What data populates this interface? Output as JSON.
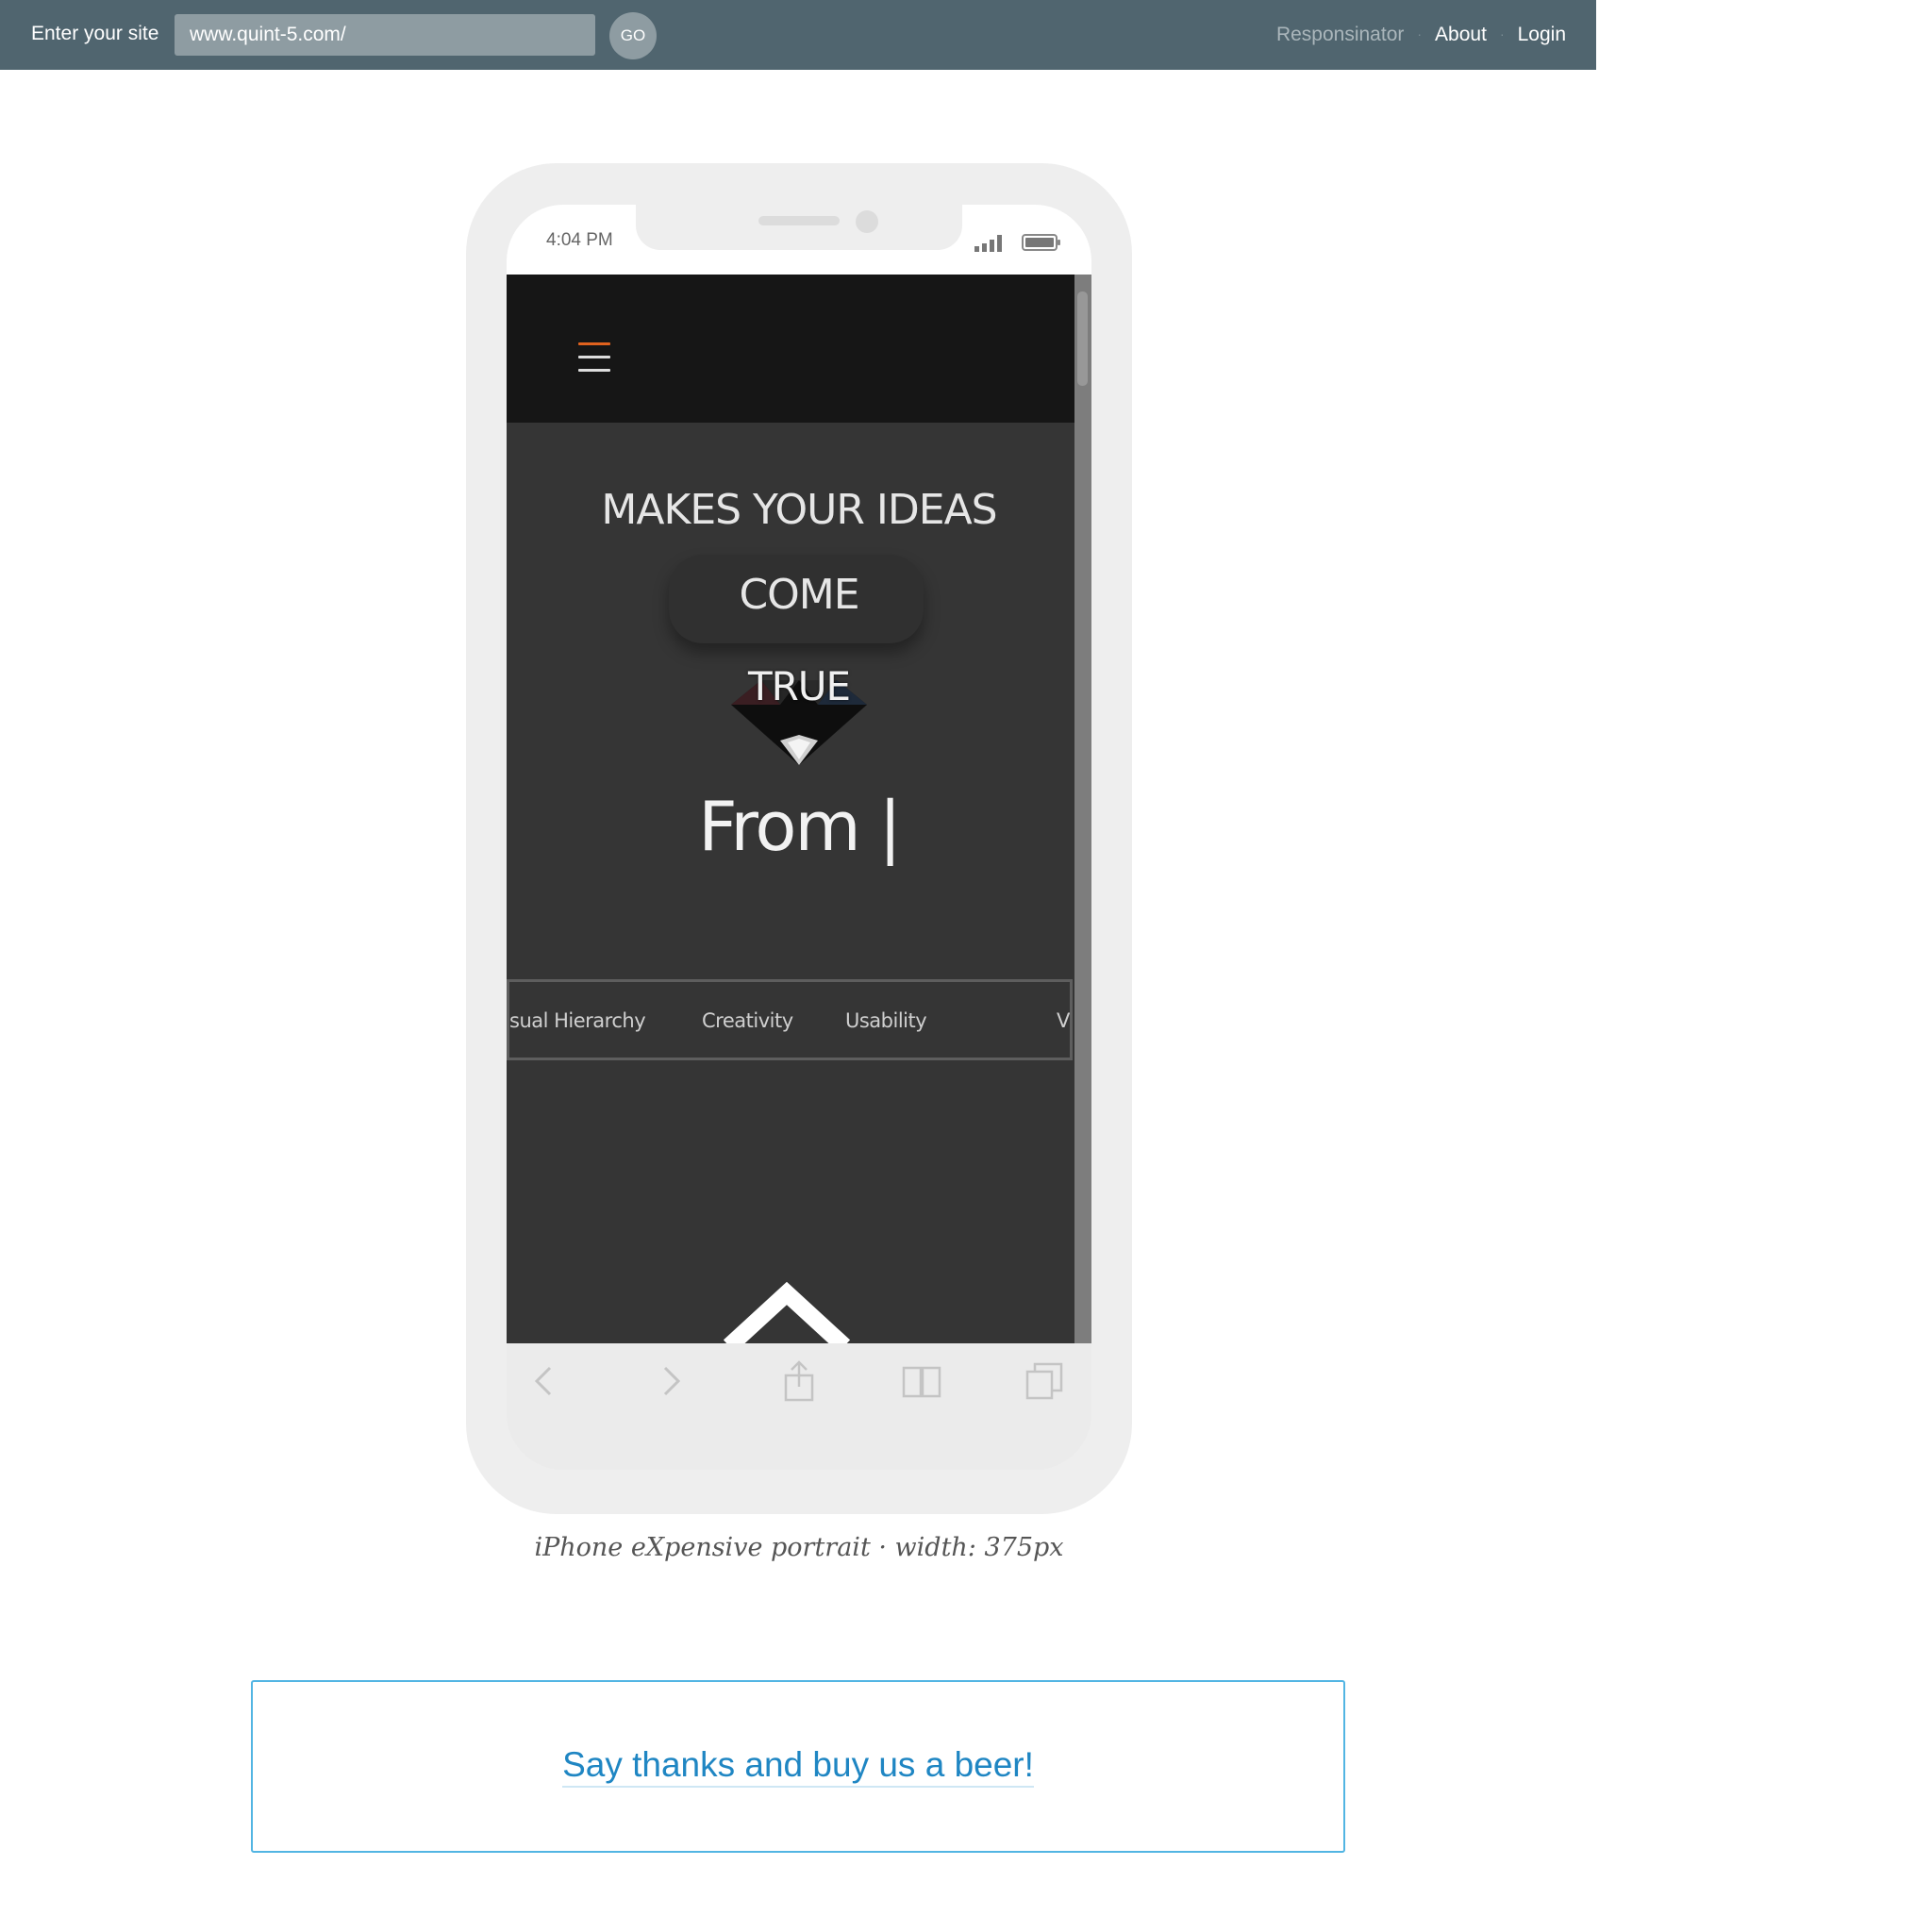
{
  "topbar": {
    "label": "Enter your site",
    "url_value": "www.quint-5.com/",
    "go_label": "GO",
    "nav": {
      "responsinator": "Responsinator",
      "separator": "·",
      "about": "About",
      "login": "Login"
    }
  },
  "device": {
    "status_time": "4:04 PM",
    "site": {
      "hero_line1": "MAKES YOUR IDEAS",
      "hero_line2": "COME",
      "hero_line3": "TRUE",
      "hero_line4": "From |",
      "ticker_items": [
        "sual Hierarchy",
        "Creativity",
        "Usability",
        "Vi"
      ]
    }
  },
  "caption": "iPhone eXpensive portrait · width: 375px",
  "donate": {
    "label": "Say thanks and buy us a beer!"
  },
  "colors": {
    "topbar_bg": "#50656f",
    "site_bg": "#353535",
    "accent_orange": "#e0621e",
    "link_blue": "#1f86c3",
    "box_border": "#52b5e3"
  },
  "icons": {
    "menu": "hamburger-icon",
    "signal": "signal-icon",
    "battery": "battery-icon",
    "logo": "diamond-icon",
    "scroll_up": "up-chevron-icon",
    "back": "chevron-left-icon",
    "forward": "chevron-right-icon",
    "share": "share-icon",
    "bookmarks": "bookmarks-icon",
    "tabs": "tabs-icon"
  }
}
